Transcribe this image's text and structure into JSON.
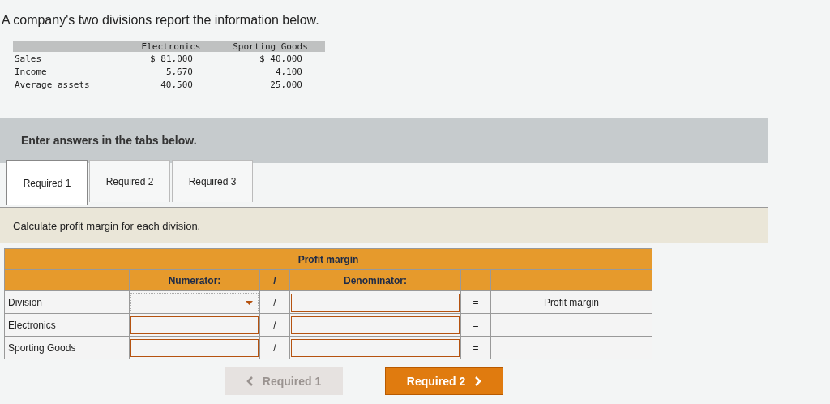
{
  "intro": "A company's two divisions report the information below.",
  "data_table": {
    "columns": [
      "Electronics",
      "Sporting Goods"
    ],
    "rows": [
      {
        "label": "Sales",
        "values": [
          "$ 81,000",
          "$ 40,000"
        ]
      },
      {
        "label": "Income",
        "values": [
          "5,670",
          "4,100"
        ]
      },
      {
        "label": "Average assets",
        "values": [
          "40,500",
          "25,000"
        ]
      }
    ]
  },
  "banner": "Enter answers in the tabs below.",
  "tabs": [
    {
      "label": "Required 1",
      "selected": true
    },
    {
      "label": "Required 2",
      "selected": false
    },
    {
      "label": "Required 3",
      "selected": false
    }
  ],
  "instruction": "Calculate profit margin for each division.",
  "answer_table": {
    "title": "Profit margin",
    "numerator_label": "Numerator:",
    "divider": "/",
    "denominator_label": "Denominator:",
    "rows": [
      {
        "label": "Division",
        "kind": "header",
        "divide": "/",
        "equals": "=",
        "result": "Profit margin"
      },
      {
        "label": "Electronics",
        "kind": "input",
        "divide": "/",
        "equals": "="
      },
      {
        "label": "Sporting Goods",
        "kind": "input",
        "divide": "/",
        "equals": "="
      }
    ]
  },
  "nav": [
    {
      "label": "Required 1",
      "kind": "prev",
      "disabled": true
    },
    {
      "label": "Required 2",
      "kind": "next",
      "disabled": false
    }
  ]
}
